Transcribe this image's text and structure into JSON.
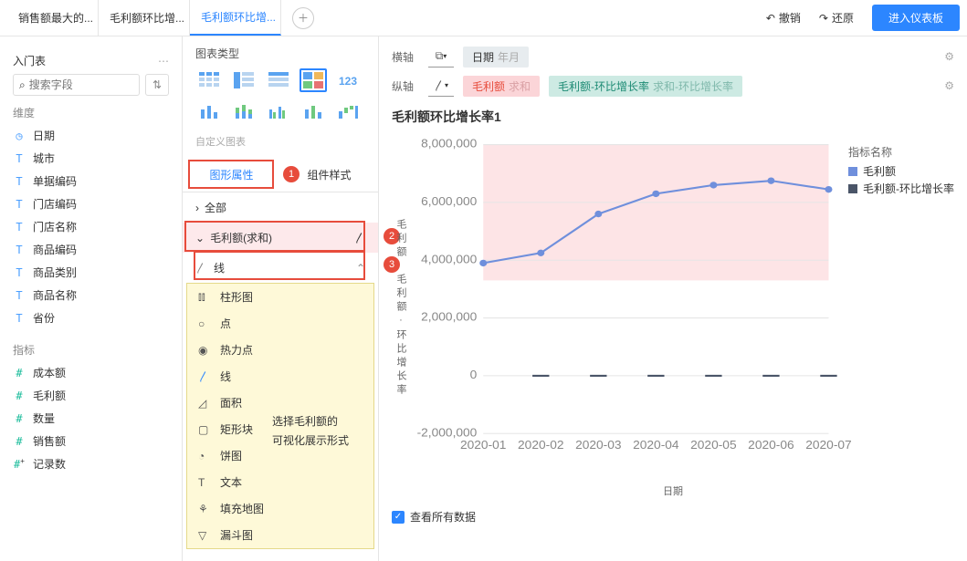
{
  "tabs": [
    "销售额最大的...",
    "毛利额环比增...",
    "毛利额环比增..."
  ],
  "active_tab": 2,
  "top": {
    "undo": "撤销",
    "redo": "还原",
    "dashboard": "进入仪表板"
  },
  "sidebar": {
    "popular": "入门表",
    "search_placeholder": "搜索字段",
    "dim_label": "维度",
    "dims": [
      "日期",
      "城市",
      "单据编码",
      "门店编码",
      "门店名称",
      "商品编码",
      "商品类别",
      "商品名称",
      "省份"
    ],
    "metric_label": "指标",
    "metrics": [
      "成本额",
      "毛利额",
      "数量",
      "销售额",
      "记录数"
    ]
  },
  "config": {
    "title": "图表类型",
    "custom": "自定义图表",
    "tab_prop": "图形属性",
    "tab_style": "组件样式",
    "all": "全部",
    "series": "毛利额(求和)",
    "line": "线",
    "dropdown": [
      "柱形图",
      "点",
      "热力点",
      "线",
      "面积",
      "矩形块",
      "饼图",
      "文本",
      "填充地图",
      "漏斗图"
    ],
    "annot1": "选择毛利额的",
    "annot2": "可视化展示形式"
  },
  "axes": {
    "h": "横轴",
    "v": "纵轴",
    "date": "日期",
    "date_sub": "年月",
    "m1a": "毛利额",
    "m1b": "求和",
    "m2a": "毛利额-环比增长率",
    "m2b": "求和-环比增长率"
  },
  "chart_data": {
    "type": "line",
    "title": "毛利额环比增长率1",
    "ylabel": "毛利额   毛利额-环比增长率",
    "xlabel": "日期",
    "ylim": [
      -2000000,
      8000000
    ],
    "yticks": [
      "8,000,000",
      "6,000,000",
      "4,000,000",
      "2,000,000",
      "0",
      "-2,000,000"
    ],
    "categories": [
      "2020-01",
      "2020-02",
      "2020-03",
      "2020-04",
      "2020-05",
      "2020-06",
      "2020-07"
    ],
    "series": [
      {
        "name": "毛利额",
        "color": "#6f8fdc",
        "values": [
          3900000,
          4250000,
          5600000,
          6300000,
          6600000,
          6750000,
          6450000
        ]
      },
      {
        "name": "毛利额-环比增长率",
        "color": "#4a5568",
        "values": [
          null,
          0,
          0,
          0,
          0,
          0,
          0
        ]
      }
    ],
    "legend_title": "指标名称"
  },
  "footer": {
    "view_all": "查看所有数据"
  }
}
